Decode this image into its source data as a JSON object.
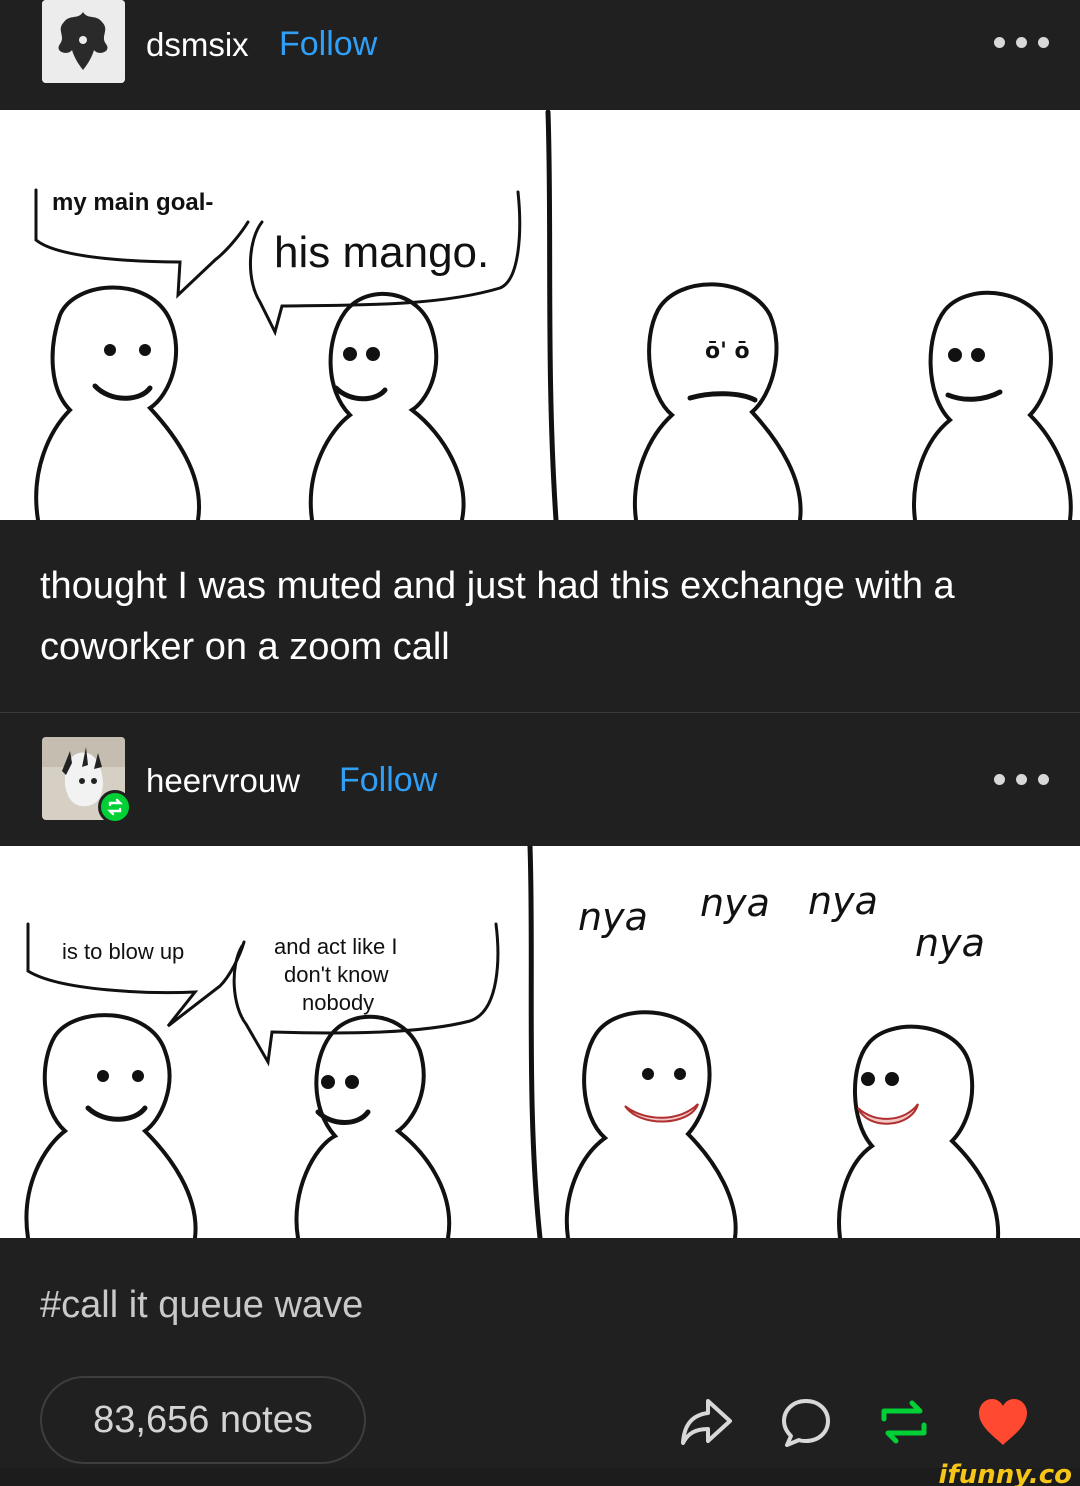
{
  "post1": {
    "username": "dsmsix",
    "follow_label": "Follow",
    "comic_text": {
      "bubble1": "my main goal-",
      "bubble2": "his mango."
    },
    "caption": "thought I was muted and just had this exchange with a coworker on a zoom call"
  },
  "post2": {
    "username": "heervrouw",
    "follow_label": "Follow",
    "comic_text": {
      "bubble1": "is to blow up",
      "bubble2_line1": "and act like I",
      "bubble2_line2": "don't know",
      "bubble2_line3": "nobody",
      "nya1": "nya",
      "nya2": "nya",
      "nya3": "nya",
      "nya4": "nya"
    },
    "tag": "#call it queue wave"
  },
  "footer": {
    "notes": "83,656 notes"
  },
  "watermark": "ifunny.co",
  "colors": {
    "background": "#202020",
    "follow": "#2f9ff8",
    "reblog": "#00cf35",
    "like": "#ff4930"
  },
  "icons": [
    "share-icon",
    "comment-icon",
    "reblog-icon",
    "heart-icon",
    "more-options-icon",
    "reblog-badge-icon"
  ]
}
